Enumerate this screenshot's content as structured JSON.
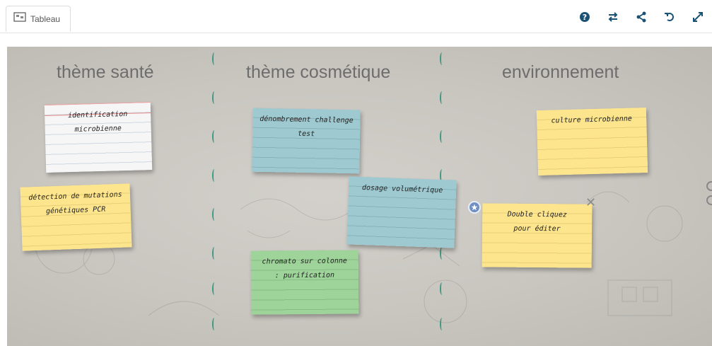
{
  "tab": {
    "label": "Tableau"
  },
  "toolbar": {
    "icons": [
      "help-icon",
      "swap-icon",
      "share-icon",
      "undo-icon",
      "fullscreen-icon"
    ]
  },
  "colors": {
    "accent": "#1a5276",
    "divider": "#3a9a82"
  },
  "columns": [
    {
      "title": "thème santé"
    },
    {
      "title": "thème cosmétique"
    },
    {
      "title": "environnement"
    }
  ],
  "notes": [
    {
      "text": "identification microbienne",
      "color": "white"
    },
    {
      "text": "détection de mutations génétiques PCR",
      "color": "yellow"
    },
    {
      "text": "dénombrement challenge test",
      "color": "teal"
    },
    {
      "text": "dosage volumétrique",
      "color": "teal"
    },
    {
      "text": "chromato sur colonne : purification",
      "color": "green"
    },
    {
      "text": "culture microbienne",
      "color": "yellow"
    },
    {
      "text": "Double cliquez pour éditer",
      "color": "yellow"
    }
  ]
}
